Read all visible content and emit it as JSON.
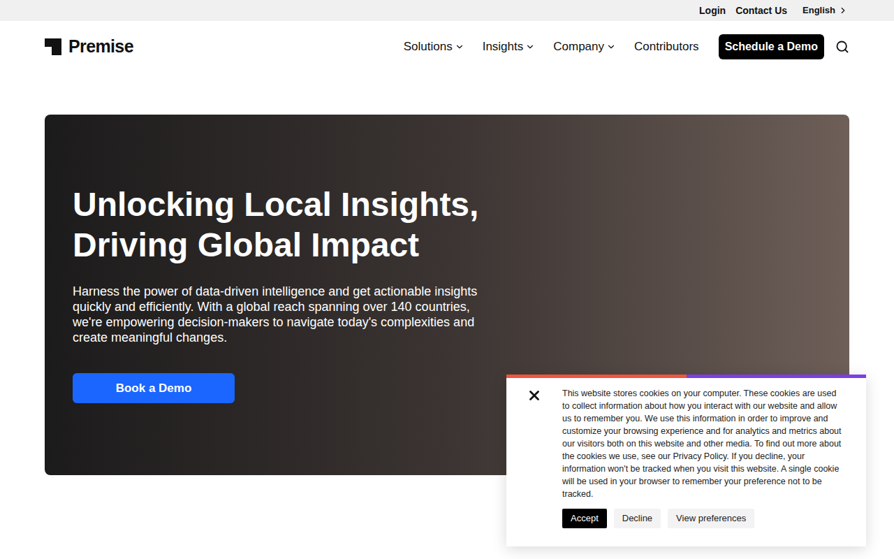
{
  "top_bar": {
    "links": [
      "Login",
      "Contact Us"
    ],
    "language": "English"
  },
  "logo": {
    "text": "Premise"
  },
  "nav": {
    "items": [
      {
        "label": "Solutions",
        "has_dropdown": true
      },
      {
        "label": "Insights",
        "has_dropdown": true
      },
      {
        "label": "Company",
        "has_dropdown": true
      },
      {
        "label": "Contributors",
        "has_dropdown": false
      }
    ],
    "cta": "Schedule a Demo"
  },
  "hero": {
    "title_lines": [
      "Unlocking Local Insights,",
      "Driving Global Impact"
    ],
    "body": "Harness the power of data-driven intelligence and get actionable insights quickly and efficiently. With a global reach spanning over 140 countries, we're empowering decision-makers to navigate today's complexities and create meaningful changes.",
    "button": "Book a Demo"
  },
  "cookie_banner": {
    "text": "This website stores cookies on your computer. These cookies are used to collect information about how you interact with our website and allow us to remember you. We use this information in order to improve and customize your browsing experience and for analytics and metrics about our visitors both on this website and other media. To find out more about the cookies we use, see our Privacy Policy. If you decline, your information won't be tracked when you visit this website. A single cookie will be used in your browser to remember your preference not to be tracked.",
    "buttons": [
      {
        "label": "Accept",
        "primary": true
      },
      {
        "label": "Decline",
        "primary": false
      },
      {
        "label": "View preferences",
        "primary": false
      }
    ]
  }
}
